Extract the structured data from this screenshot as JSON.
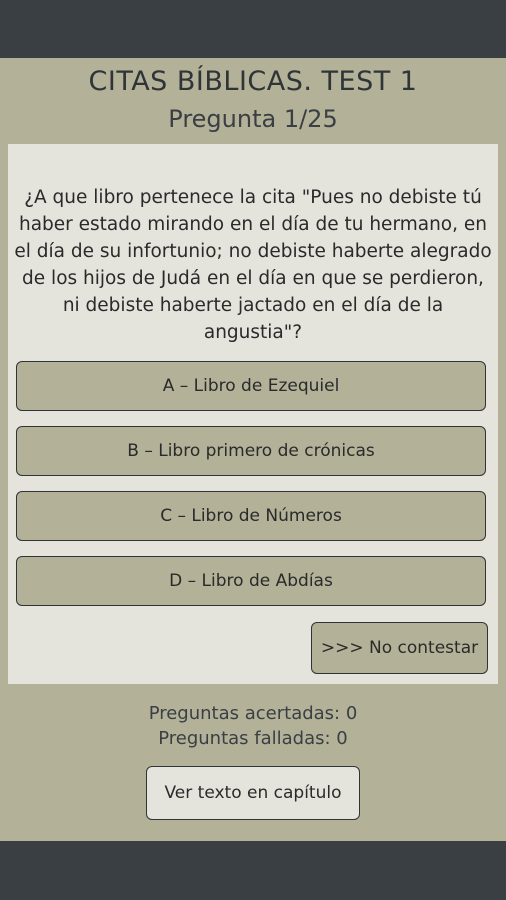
{
  "header": {
    "title": "CITAS BÍBLICAS. TEST 1",
    "subtitle": "Pregunta 1/25"
  },
  "question": {
    "text": "¿A que libro pertenece la cita \"Pues no debiste tú haber estado mirando en el día de tu hermano, en el día de su infortunio; no debiste haberte alegrado de los hijos de Judá en el día en que se perdieron, ni debiste haberte jactado en el día de la angustia\"?"
  },
  "answers": [
    {
      "label": "A – Libro de Ezequiel"
    },
    {
      "label": "B – Libro primero de crónicas"
    },
    {
      "label": "C – Libro de Números"
    },
    {
      "label": "D – Libro de Abdías"
    }
  ],
  "skip_label": ">>> No contestar",
  "stats": {
    "correct": "Preguntas acertadas: 0",
    "wrong": "Preguntas falladas: 0"
  },
  "view_chapter_label": "Ver texto en capítulo",
  "colors": {
    "background": "#b3b198",
    "panel": "#e4e3dc",
    "dark_bar": "#3a3f44",
    "text": "#2f3437"
  }
}
